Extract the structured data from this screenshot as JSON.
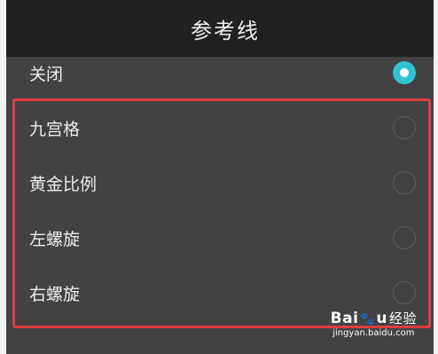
{
  "header": {
    "title": "参考线"
  },
  "options": [
    {
      "label": "关闭",
      "selected": true
    },
    {
      "label": "九宫格",
      "selected": false
    },
    {
      "label": "黄金比例",
      "selected": false
    },
    {
      "label": "左螺旋",
      "selected": false
    },
    {
      "label": "右螺旋",
      "selected": false
    }
  ],
  "watermark": {
    "logo_text": "Bai",
    "logo_text_2": "u",
    "logo_suffix": "经验",
    "url": "jingyan.baidu.com"
  },
  "colors": {
    "accent": "#32c3d3",
    "highlight": "#e23c3c",
    "header_bg": "#202020",
    "panel_bg": "#424242"
  }
}
